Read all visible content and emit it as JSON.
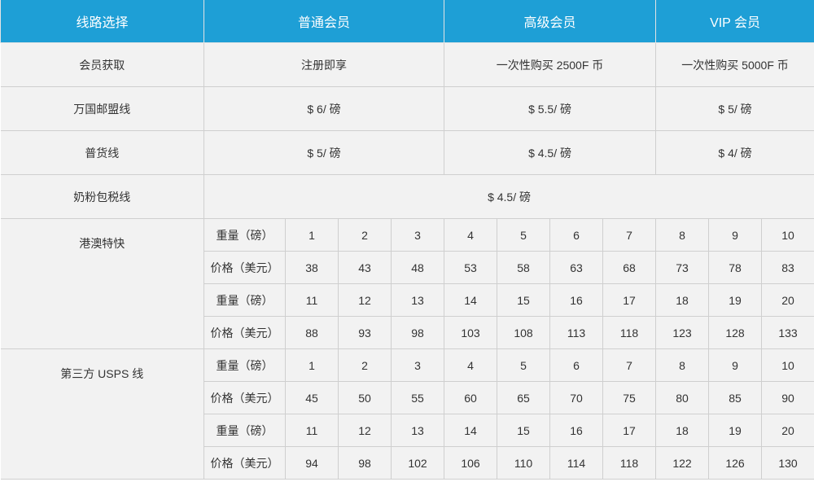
{
  "header": {
    "route": "线路选择",
    "regular": "普通会员",
    "senior": "高级会员",
    "vip": "VIP 会员"
  },
  "membership": {
    "label": "会员获取",
    "regular": "注册即享",
    "senior": "一次性购买 2500F 币",
    "vip": "一次性购买 5000F 币"
  },
  "wanguo": {
    "label": "万国邮盟线",
    "regular": "$ 6/ 磅",
    "senior": "$ 5.5/ 磅",
    "vip": "$ 5/ 磅"
  },
  "general": {
    "label": "普货线",
    "regular": "$ 5/ 磅",
    "senior": "$ 4.5/ 磅",
    "vip": "$ 4/ 磅"
  },
  "milk": {
    "label": "奶粉包税线",
    "price": "$ 4.5/ 磅"
  },
  "hk": {
    "label": "港澳特快",
    "rows": [
      {
        "label": "重量（磅）",
        "cells": [
          "1",
          "2",
          "3",
          "4",
          "5",
          "6",
          "7",
          "8",
          "9",
          "10"
        ]
      },
      {
        "label": "价格（美元）",
        "cells": [
          "38",
          "43",
          "48",
          "53",
          "58",
          "63",
          "68",
          "73",
          "78",
          "83"
        ]
      },
      {
        "label": "重量（磅）",
        "cells": [
          "11",
          "12",
          "13",
          "14",
          "15",
          "16",
          "17",
          "18",
          "19",
          "20"
        ]
      },
      {
        "label": "价格（美元）",
        "cells": [
          "88",
          "93",
          "98",
          "103",
          "108",
          "113",
          "118",
          "123",
          "128",
          "133"
        ]
      }
    ]
  },
  "usps": {
    "label": "第三方 USPS 线",
    "rows": [
      {
        "label": "重量（磅）",
        "cells": [
          "1",
          "2",
          "3",
          "4",
          "5",
          "6",
          "7",
          "8",
          "9",
          "10"
        ]
      },
      {
        "label": "价格（美元）",
        "cells": [
          "45",
          "50",
          "55",
          "60",
          "65",
          "70",
          "75",
          "80",
          "85",
          "90"
        ]
      },
      {
        "label": "重量（磅）",
        "cells": [
          "11",
          "12",
          "13",
          "14",
          "15",
          "16",
          "17",
          "18",
          "19",
          "20"
        ]
      },
      {
        "label": "价格（美元）",
        "cells": [
          "94",
          "98",
          "102",
          "106",
          "110",
          "114",
          "118",
          "122",
          "126",
          "130"
        ]
      }
    ]
  }
}
